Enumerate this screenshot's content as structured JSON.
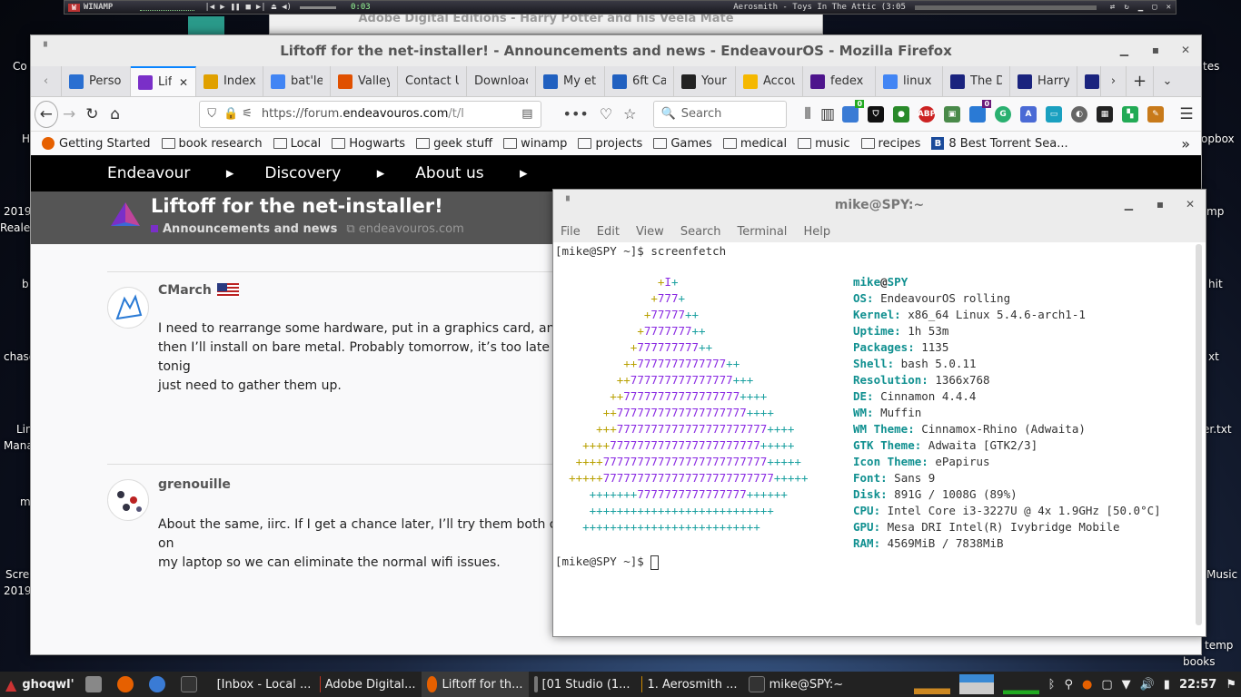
{
  "winamp": {
    "title": "WINAMP",
    "time": "0:03",
    "song": "Aerosmith - Toys In The Attic (3:05"
  },
  "background_window_title": "Adobe Digital Editions - Harry Potter and his Veela Mate",
  "desktop": {
    "left_labels": [
      "Co",
      "H",
      "2019",
      "Reale",
      "b",
      "chase",
      "Lin",
      "Mana",
      "m",
      "Scre",
      "2019"
    ],
    "right_labels": [
      "tes",
      "opbox",
      "mp",
      "hit",
      "xt",
      "er.txt",
      "Music",
      "temp",
      "books"
    ]
  },
  "firefox": {
    "window_title": "Liftoff for the net-installer! - Announcements and news - EndeavourOS - Mozilla Firefox",
    "tabs": [
      {
        "label": "Perso",
        "icon": "wp-icon",
        "color": "#2a6fd1"
      },
      {
        "label": "Lif",
        "icon": "endeavour-icon",
        "color": "#7a2fc8",
        "active": true
      },
      {
        "label": "Index",
        "icon": "index-icon",
        "color": "#e0a000"
      },
      {
        "label": "bat'le",
        "icon": "google-icon",
        "color": "#4285f4"
      },
      {
        "label": "Valley",
        "icon": "valley-icon",
        "color": "#e05000"
      },
      {
        "label": "Contact U",
        "icon": "",
        "color": ""
      },
      {
        "label": "Downloac",
        "icon": "",
        "color": ""
      },
      {
        "label": "My et",
        "icon": "lib-icon",
        "color": "#2060c0"
      },
      {
        "label": "6ft Ca",
        "icon": "lib-icon",
        "color": "#2060c0"
      },
      {
        "label": "Your O",
        "icon": "amazon-icon",
        "color": "#222"
      },
      {
        "label": "Accou",
        "icon": "walmart-icon",
        "color": "#f5b800"
      },
      {
        "label": "fedex",
        "icon": "fedex-icon",
        "color": "#4d148c"
      },
      {
        "label": "linux",
        "icon": "google-icon",
        "color": "#4285f4"
      },
      {
        "label": "The D",
        "icon": "ao3-icon",
        "color": "#1a237e"
      },
      {
        "label": "Harry",
        "icon": "ao3-icon",
        "color": "#1a237e"
      }
    ],
    "url": {
      "prefix": "https://forum.",
      "domain": "endeavouros.com",
      "rest": "/t/l"
    },
    "search_placeholder": "Search",
    "bookmarks": [
      "Getting Started",
      "book research",
      "Local",
      "Hogwarts",
      "geek stuff",
      "winamp",
      "projects",
      "Games",
      "medical",
      "music",
      "recipes",
      "8 Best Torrent Sea..."
    ],
    "ext_badges": {
      "first": "0",
      "second": "0"
    }
  },
  "forum": {
    "nav": [
      "Endeavour",
      "Discovery",
      "About us"
    ],
    "topic_title": "Liftoff for the net-installer!",
    "category": "Announcements and news",
    "site_link": "endeavouros.com",
    "posts": [
      {
        "user": "CMarch",
        "lines": [
          "I need to rearrange some hardware, put in a graphics card, and at",
          "then I’ll install on bare metal. Probably tomorrow, it’s too late tonig",
          "just need to gather them up."
        ]
      },
      {
        "user": "grenouille",
        "lines": [
          "About the same, iirc. If I get a chance later, I’ll try them both on on",
          "my laptop so we can eliminate the normal wifi issues."
        ]
      }
    ]
  },
  "terminal": {
    "title": "mike@SPY:~",
    "menu": [
      "File",
      "Edit",
      "View",
      "Search",
      "Terminal",
      "Help"
    ],
    "command_line": "[mike@SPY ~]$ screenfetch",
    "prompt": "[mike@SPY ~]$ ",
    "user_host": {
      "user": "mike",
      "at": "@",
      "host": "SPY"
    },
    "info": [
      {
        "key": "OS:",
        "value": " EndeavourOS rolling"
      },
      {
        "key": "Kernel:",
        "value": " x86_64 Linux 5.4.6-arch1-1"
      },
      {
        "key": "Uptime:",
        "value": " 1h 53m"
      },
      {
        "key": "Packages:",
        "value": " 1135"
      },
      {
        "key": "Shell:",
        "value": " bash 5.0.11"
      },
      {
        "key": "Resolution:",
        "value": " 1366x768"
      },
      {
        "key": "DE:",
        "value": " Cinnamon 4.4.4"
      },
      {
        "key": "WM:",
        "value": " Muffin"
      },
      {
        "key": "WM Theme:",
        "value": " Cinnamox-Rhino (Adwaita)"
      },
      {
        "key": "GTK Theme:",
        "value": " Adwaita [GTK2/3]"
      },
      {
        "key": "Icon Theme:",
        "value": " ePapirus"
      },
      {
        "key": "Font:",
        "value": " Sans 9"
      },
      {
        "key": "Disk:",
        "value": " 891G / 1008G (89%)"
      },
      {
        "key": "CPU:",
        "value": " Intel Core i3-3227U @ 4x 1.9GHz [50.0°C]"
      },
      {
        "key": "GPU:",
        "value": " Mesa DRI Intel(R) Ivybridge Mobile"
      },
      {
        "key": "RAM:",
        "value": " 4569MiB / 7838MiB"
      }
    ],
    "art": [
      {
        "pad": "               ",
        "y": "+",
        "p": "I",
        "c": "+"
      },
      {
        "pad": "              ",
        "y": "+",
        "p": "777",
        "c": "+"
      },
      {
        "pad": "             ",
        "y": "+",
        "p": "77777",
        "c": "++"
      },
      {
        "pad": "            ",
        "y": "+",
        "p": "7777777",
        "c": "++"
      },
      {
        "pad": "           ",
        "y": "+",
        "p": "777777777",
        "c": "++"
      },
      {
        "pad": "          ",
        "y": "++",
        "p": "7777777777777",
        "c": "++"
      },
      {
        "pad": "         ",
        "y": "++",
        "p": "777777777777777",
        "c": "+++"
      },
      {
        "pad": "        ",
        "y": "++",
        "p": "77777777777777777",
        "c": "++++"
      },
      {
        "pad": "       ",
        "y": "++",
        "p": "7777777777777777777",
        "c": "++++"
      },
      {
        "pad": "      ",
        "y": "+++",
        "p": "7777777777777777777777",
        "c": "++++"
      },
      {
        "pad": "    ",
        "y": "++++",
        "p": "7777777777777777777777",
        "c": "+++++"
      },
      {
        "pad": "   ",
        "y": "++++",
        "p": "777777777777777777777777",
        "c": "+++++"
      },
      {
        "pad": "  ",
        "y": "+++++",
        "p": "7777777777777777777777777",
        "c": "+++++"
      },
      {
        "pad": "     ",
        "y": "",
        "p": "",
        "c": "+++++++",
        "p2": "7777777777777777",
        "c2": "++++++"
      },
      {
        "pad": "     ",
        "y": "",
        "p": "",
        "c": "+++++++++++++++++++++++++++"
      },
      {
        "pad": "    ",
        "y": "",
        "p": "",
        "c": "++++++++++++++++++++++++++"
      }
    ]
  },
  "taskbar": {
    "start_label": "ghoqwl'",
    "windows": [
      "[Inbox - Local ...",
      "Adobe Digital...",
      "Liftoff for th...",
      "[01 Studio (1...",
      "1. Aerosmith ...",
      "mike@SPY:~"
    ],
    "clock": "22:57"
  }
}
